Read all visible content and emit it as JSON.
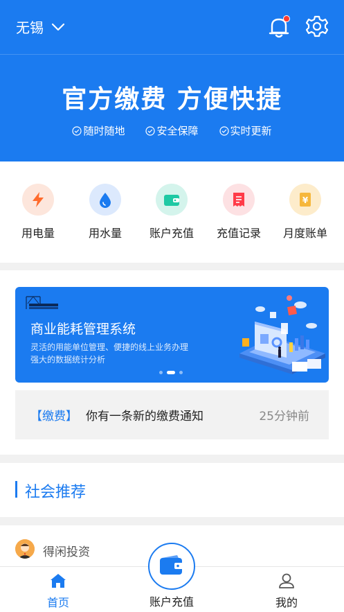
{
  "header": {
    "city": "无锡",
    "slogan": "官方缴费 方便快捷",
    "features": [
      "随时随地",
      "安全保障",
      "实时更新"
    ],
    "has_notification": true
  },
  "quick_actions": [
    {
      "label": "用电量",
      "icon": "lightning-icon",
      "color": "#ff6b2c"
    },
    {
      "label": "用水量",
      "icon": "water-drop-icon",
      "color": "#1b7bf0"
    },
    {
      "label": "账户充值",
      "icon": "wallet-icon",
      "color": "#1fc9a4"
    },
    {
      "label": "充值记录",
      "icon": "receipt-icon",
      "color": "#ff3b48"
    },
    {
      "label": "月度账单",
      "icon": "yen-bill-icon",
      "color": "#f6b73c"
    }
  ],
  "banner": {
    "title": "商业能耗管理系统",
    "subtitle_line1": "灵活的用能单位管理、便捷的线上业务办理",
    "subtitle_line2": "强大的数据统计分析",
    "slides": 3,
    "active_slide": 2
  },
  "notice": {
    "tag": "【缴费】",
    "text": "你有一条新的缴费通知",
    "time": "25分钟前"
  },
  "section": {
    "title": "社会推荐"
  },
  "recommendation": {
    "name": "得闲投资"
  },
  "tabbar": {
    "home": "首页",
    "recharge": "账户充值",
    "mine": "我的"
  },
  "colors": {
    "primary": "#1b7bf0",
    "badge": "#ff3b30"
  }
}
